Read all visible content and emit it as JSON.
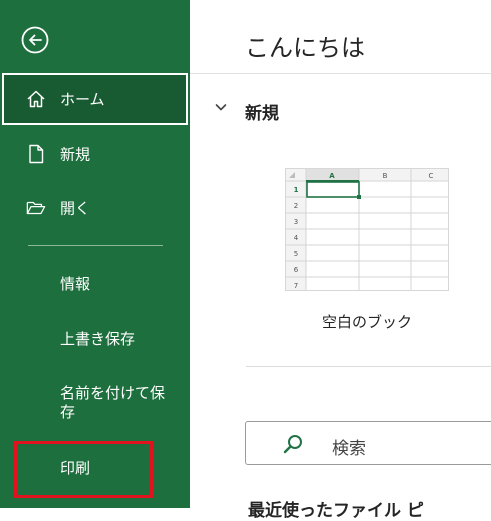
{
  "sidebar": {
    "back_icon": "back-arrow-icon",
    "items": [
      {
        "label": "ホーム",
        "icon": "home-icon"
      },
      {
        "label": "新規",
        "icon": "new-document-icon"
      },
      {
        "label": "開く",
        "icon": "open-folder-icon"
      }
    ],
    "sub_items": [
      "情報",
      "上書き保存",
      "名前を付けて保",
      "存",
      "印刷"
    ],
    "colors": {
      "background": "#1e6f3e",
      "selected": "#185a32",
      "highlight_border": "#e0141e"
    }
  },
  "main": {
    "greeting": "こんにちは",
    "new_section": {
      "title": "新規",
      "template_caption": "空白のブック",
      "thumbnail": {
        "columns": [
          "A",
          "B",
          "C"
        ],
        "rows": [
          "1",
          "2",
          "3",
          "4",
          "5",
          "6",
          "7"
        ]
      }
    },
    "search": {
      "placeholder": "検索",
      "icon": "search-icon"
    },
    "cut_off_text": "最近使ったファイル ピ"
  }
}
